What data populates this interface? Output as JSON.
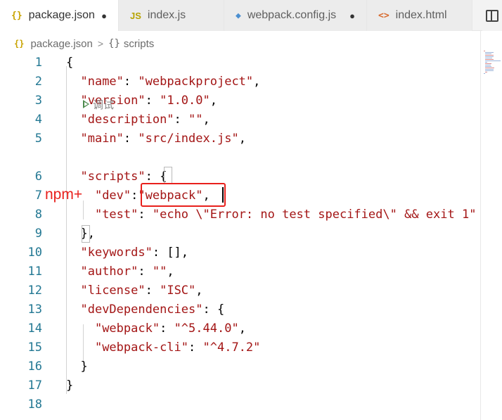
{
  "tabs": [
    {
      "icon": "{}",
      "icon_name": "json-braces-icon",
      "label": "package.json",
      "modified": true,
      "active": true
    },
    {
      "icon": "JS",
      "icon_name": "javascript-icon",
      "label": "index.js",
      "modified": false,
      "active": false
    },
    {
      "icon": "◆",
      "icon_name": "webpack-cube-icon",
      "label": "webpack.config.js",
      "modified": true,
      "active": false
    },
    {
      "icon": "<>",
      "icon_name": "html-icon",
      "label": "index.html",
      "modified": false,
      "active": false
    }
  ],
  "modified_dot": "●",
  "breadcrumb": {
    "file_icon": "{}",
    "file": "package.json",
    "separator": ">",
    "section_icon": "{}",
    "section": "scripts"
  },
  "codelens": {
    "label": "调试"
  },
  "annotation": {
    "label": "npm+",
    "color": "#e8201c"
  },
  "colors": {
    "key": "#a31515",
    "string": "#a31515",
    "line_number": "#237893",
    "annotation": "#e8201c"
  },
  "lines": [
    {
      "num": "1",
      "tokens": [
        [
          "p",
          "{"
        ]
      ]
    },
    {
      "num": "2",
      "tokens": [
        [
          "p",
          "  "
        ],
        [
          "k",
          "\"name\""
        ],
        [
          "p",
          ": "
        ],
        [
          "s",
          "\"webpackproject\""
        ],
        [
          "p",
          ","
        ]
      ]
    },
    {
      "num": "3",
      "tokens": [
        [
          "p",
          "  "
        ],
        [
          "k",
          "\"version\""
        ],
        [
          "p",
          ": "
        ],
        [
          "s",
          "\"1.0.0\""
        ],
        [
          "p",
          ","
        ]
      ]
    },
    {
      "num": "4",
      "tokens": [
        [
          "p",
          "  "
        ],
        [
          "k",
          "\"description\""
        ],
        [
          "p",
          ": "
        ],
        [
          "s",
          "\"\""
        ],
        [
          "p",
          ","
        ]
      ]
    },
    {
      "num": "5",
      "tokens": [
        [
          "p",
          "  "
        ],
        [
          "k",
          "\"main\""
        ],
        [
          "p",
          ": "
        ],
        [
          "s",
          "\"src/index.js\""
        ],
        [
          "p",
          ","
        ]
      ]
    },
    {
      "num": "6",
      "tokens": [
        [
          "p",
          "  "
        ],
        [
          "k",
          "\"scripts\""
        ],
        [
          "p",
          ": {"
        ]
      ]
    },
    {
      "num": "7",
      "tokens": [
        [
          "p",
          "    "
        ],
        [
          "k",
          "\"dev\""
        ],
        [
          "p",
          ":"
        ],
        [
          "s",
          "\"webpack\""
        ],
        [
          "p",
          ","
        ]
      ]
    },
    {
      "num": "8",
      "tokens": [
        [
          "p",
          "    "
        ],
        [
          "k",
          "\"test\""
        ],
        [
          "p",
          ": "
        ],
        [
          "s",
          "\"echo \\\"Error: no test specified\\\" && exit 1\""
        ]
      ]
    },
    {
      "num": "9",
      "tokens": [
        [
          "p",
          "  },"
        ]
      ]
    },
    {
      "num": "10",
      "tokens": [
        [
          "p",
          "  "
        ],
        [
          "k",
          "\"keywords\""
        ],
        [
          "p",
          ": [],"
        ]
      ]
    },
    {
      "num": "11",
      "tokens": [
        [
          "p",
          "  "
        ],
        [
          "k",
          "\"author\""
        ],
        [
          "p",
          ": "
        ],
        [
          "s",
          "\"\""
        ],
        [
          "p",
          ","
        ]
      ]
    },
    {
      "num": "12",
      "tokens": [
        [
          "p",
          "  "
        ],
        [
          "k",
          "\"license\""
        ],
        [
          "p",
          ": "
        ],
        [
          "s",
          "\"ISC\""
        ],
        [
          "p",
          ","
        ]
      ]
    },
    {
      "num": "13",
      "tokens": [
        [
          "p",
          "  "
        ],
        [
          "k",
          "\"devDependencies\""
        ],
        [
          "p",
          ": {"
        ]
      ]
    },
    {
      "num": "14",
      "tokens": [
        [
          "p",
          "    "
        ],
        [
          "k",
          "\"webpack\""
        ],
        [
          "p",
          ": "
        ],
        [
          "s",
          "\"^5.44.0\""
        ],
        [
          "p",
          ","
        ]
      ]
    },
    {
      "num": "15",
      "tokens": [
        [
          "p",
          "    "
        ],
        [
          "k",
          "\"webpack-cli\""
        ],
        [
          "p",
          ": "
        ],
        [
          "s",
          "\"^4.7.2\""
        ]
      ]
    },
    {
      "num": "16",
      "tokens": [
        [
          "p",
          "  }"
        ]
      ]
    },
    {
      "num": "17",
      "tokens": [
        [
          "p",
          "}"
        ]
      ]
    },
    {
      "num": "18",
      "tokens": []
    }
  ]
}
